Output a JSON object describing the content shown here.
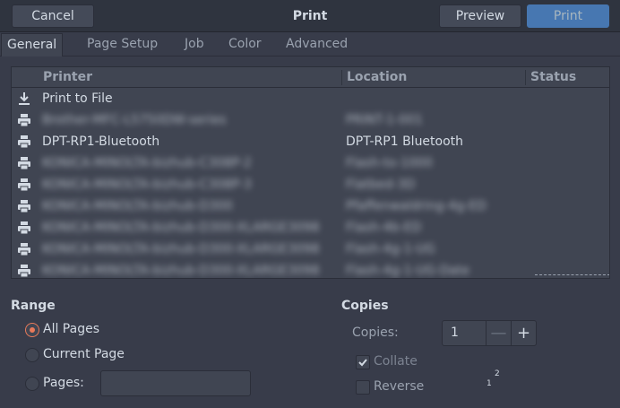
{
  "header": {
    "title": "Print",
    "cancel_label": "Cancel",
    "preview_label": "Preview",
    "print_label": "Print"
  },
  "tabs": [
    {
      "label": "General",
      "active": true
    },
    {
      "label": "Page Setup"
    },
    {
      "label": "Job"
    },
    {
      "label": "Color"
    },
    {
      "label": "Advanced"
    }
  ],
  "printer_list": {
    "columns": {
      "printer": "Printer",
      "location": "Location",
      "status": "Status"
    },
    "rows": [
      {
        "icon": "download-icon",
        "name": "Print to File",
        "location": "",
        "blurred": false
      },
      {
        "icon": "printer-icon",
        "name": "Brother-MFC-L5750DW-series",
        "location": "PRINT-1-001",
        "blurred": true
      },
      {
        "icon": "printer-icon",
        "name": "DPT-RP1-Bluetooth",
        "location": "DPT-RP1 Bluetooth",
        "blurred": false
      },
      {
        "icon": "printer-icon",
        "name": "KONICA-MINOLTA-bizhub-C308P-2",
        "location": "Flash-to-1000",
        "blurred": true
      },
      {
        "icon": "printer-icon",
        "name": "KONICA-MINOLTA-bizhub-C308P-3",
        "location": "Flatbed-3D",
        "blurred": true
      },
      {
        "icon": "printer-icon",
        "name": "KONICA-MINOLTA-bizhub-D300",
        "location": "Pfaffenwaldring-4g-ED",
        "blurred": true
      },
      {
        "icon": "printer-icon",
        "name": "KONICA-MINOLTA-bizhub-D300-XLARGE3098",
        "location": "Flash-4b-ED",
        "blurred": true
      },
      {
        "icon": "printer-icon",
        "name": "KONICA-MINOLTA-bizhub-D300-XLARGE3098",
        "location": "Flash-4g-1-UG",
        "blurred": true
      },
      {
        "icon": "printer-icon",
        "name": "KONICA-MINOLTA-bizhub-D300-XLARGE3098",
        "location": "Flash-4g-1-UG-Date",
        "blurred": true
      }
    ]
  },
  "range": {
    "title": "Range",
    "all_pages": "All Pages",
    "current_page": "Current Page",
    "pages": "Pages:",
    "pages_value": ""
  },
  "copies": {
    "title": "Copies",
    "copies_label": "Copies:",
    "copies_value": "1",
    "minus": "—",
    "plus": "+",
    "collate_label": "Collate",
    "collate_checked": true,
    "reverse_label": "Reverse",
    "reverse_checked": false,
    "collate_preview": [
      "2",
      "1"
    ]
  },
  "colors": {
    "accent": "#5294e2",
    "radio_checked": "#e87a5a",
    "background": "#383c4a"
  }
}
